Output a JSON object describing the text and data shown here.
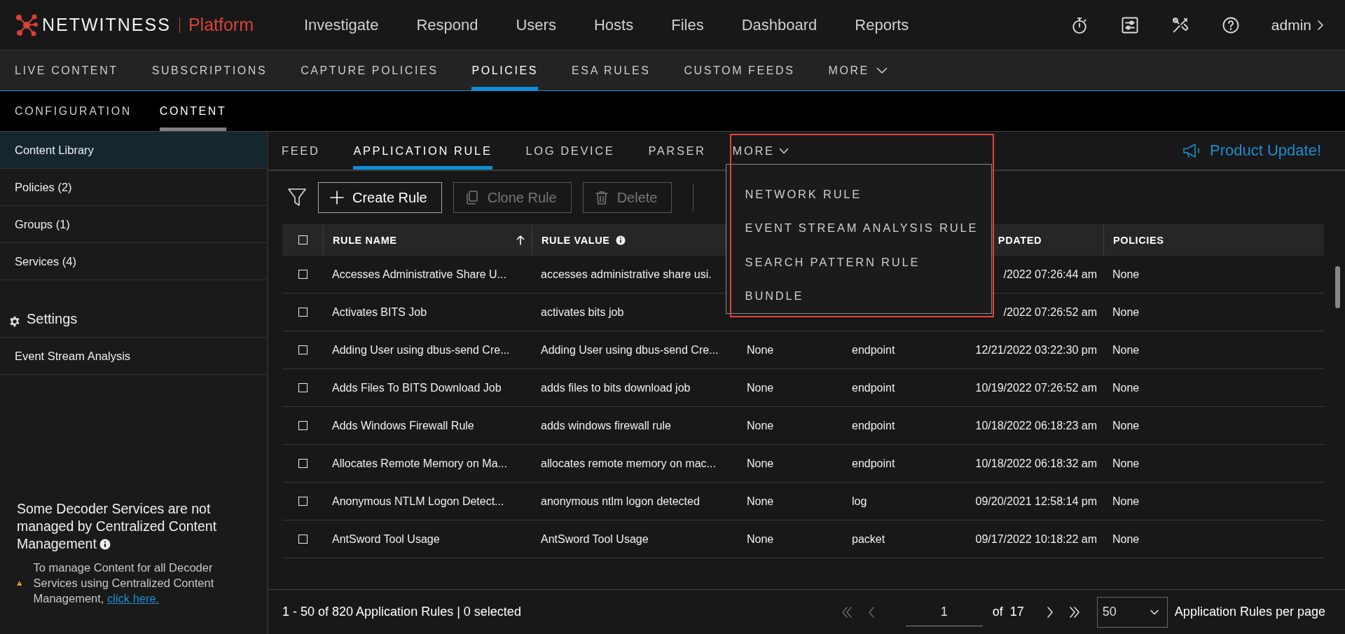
{
  "brand": {
    "name": "NETWITNESS",
    "product": "Platform"
  },
  "main_nav": [
    {
      "label": "Investigate"
    },
    {
      "label": "Respond"
    },
    {
      "label": "Users"
    },
    {
      "label": "Hosts"
    },
    {
      "label": "Files"
    },
    {
      "label": "Dashboard"
    },
    {
      "label": "Reports"
    }
  ],
  "user": {
    "label": "admin"
  },
  "section_nav": {
    "items": [
      {
        "label": "LIVE CONTENT",
        "selected": false
      },
      {
        "label": "SUBSCRIPTIONS",
        "selected": false
      },
      {
        "label": "CAPTURE POLICIES",
        "selected": false
      },
      {
        "label": "POLICIES",
        "selected": true
      },
      {
        "label": "ESA RULES",
        "selected": false
      },
      {
        "label": "CUSTOM FEEDS",
        "selected": false
      }
    ],
    "more": "MORE"
  },
  "sub_nav": [
    {
      "label": "CONFIGURATION",
      "selected": false
    },
    {
      "label": "CONTENT",
      "selected": true
    }
  ],
  "sidebar": {
    "items": [
      {
        "label": "Content Library",
        "selected": true
      },
      {
        "label": "Policies (2)",
        "selected": false
      },
      {
        "label": "Groups (1)",
        "selected": false
      },
      {
        "label": "Services (4)",
        "selected": false
      }
    ],
    "settings": {
      "label": "Settings",
      "items": [
        {
          "label": "Event Stream Analysis",
          "selected": false
        }
      ]
    },
    "notice": {
      "title": "Some Decoder Services are not managed by Centralized Content Management",
      "text": "To manage Content for all Decoder Services using Centralized Content Management,",
      "link": "click here."
    }
  },
  "content_tabs": [
    {
      "label": "FEED",
      "selected": false
    },
    {
      "label": "APPLICATION RULE",
      "selected": true
    },
    {
      "label": "LOG DEVICE",
      "selected": false
    },
    {
      "label": "PARSER",
      "selected": false
    }
  ],
  "more_menu": {
    "label": "MORE",
    "expanded": true,
    "items": [
      {
        "label": "NETWORK RULE"
      },
      {
        "label": "EVENT STREAM ANALYSIS RULE"
      },
      {
        "label": "SEARCH PATTERN RULE"
      },
      {
        "label": "BUNDLE"
      }
    ]
  },
  "product_update": "Product Update!",
  "toolbar": [
    {
      "kind": "create",
      "label": "Create Rule",
      "disabled": false
    },
    {
      "kind": "clone",
      "label": "Clone Rule",
      "disabled": true
    },
    {
      "kind": "delete",
      "label": "Delete",
      "disabled": true
    }
  ],
  "table": {
    "select_all": {
      "checked": false
    },
    "header": {
      "rule_name": {
        "label": "RULE NAME",
        "sort_ascending": true
      },
      "rule_value": {
        "label": "RULE VALUE",
        "info": true
      },
      "column_5": {
        "label": "PDATED"
      },
      "column_6": {
        "label": "POLICIES"
      }
    },
    "rows": [
      {
        "checked": false,
        "rule_name": "Accesses Administrative Share U...",
        "rule_value": "accesses administrative share usi.",
        "column_5": "/2022 07:26:44 am",
        "column_6": "None"
      },
      {
        "checked": false,
        "rule_name": "Activates BITS Job",
        "rule_value": "activates bits job",
        "column_5": "/2022 07:26:52 am",
        "column_6": "None"
      },
      {
        "checked": false,
        "rule_name": "Adding User using dbus-send Cre...",
        "rule_value": "Adding User using dbus-send Cre...",
        "column_3": "None",
        "column_4": "endpoint",
        "column_5": "12/21/2022 03:22:30 pm",
        "column_6": "None"
      },
      {
        "checked": false,
        "rule_name": "Adds Files To BITS Download Job",
        "rule_value": "adds files to bits download job",
        "column_3": "None",
        "column_4": "endpoint",
        "column_5": "10/19/2022 07:26:52 am",
        "column_6": "None"
      },
      {
        "checked": false,
        "rule_name": "Adds Windows Firewall Rule",
        "rule_value": "adds windows firewall rule",
        "column_3": "None",
        "column_4": "endpoint",
        "column_5": "10/18/2022 06:18:23 am",
        "column_6": "None"
      },
      {
        "checked": false,
        "rule_name": "Allocates Remote Memory on Ma...",
        "rule_value": "allocates remote memory on mac...",
        "column_3": "None",
        "column_4": "endpoint",
        "column_5": "10/18/2022 06:18:32 am",
        "column_6": "None"
      },
      {
        "checked": false,
        "rule_name": "Anonymous NTLM Logon Detect...",
        "rule_value": "anonymous ntlm logon detected",
        "column_3": "None",
        "column_4": "log",
        "column_5": "09/20/2021 12:58:14 pm",
        "column_6": "None"
      },
      {
        "checked": false,
        "rule_name": "AntSword Tool Usage",
        "rule_value": "AntSword Tool Usage",
        "column_3": "None",
        "column_4": "packet",
        "column_5": "09/17/2022 10:18:22 am",
        "column_6": "None"
      }
    ]
  },
  "footer": {
    "summary": "1 - 50 of 820 Application Rules | 0 selected",
    "first_disabled": true,
    "prev_disabled": true,
    "page": "1",
    "of": "of",
    "total": "17",
    "next_disabled": false,
    "last_disabled": false,
    "page_size": "50",
    "per_page": "Application Rules per page"
  }
}
